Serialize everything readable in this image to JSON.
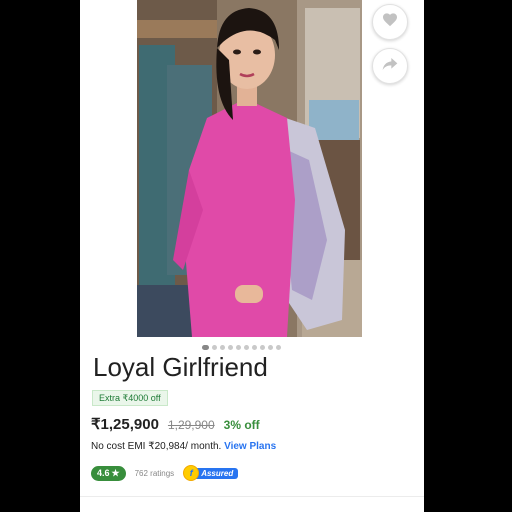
{
  "product": {
    "title": "Loyal Girlfriend",
    "extra_offer": "Extra ₹4000 off",
    "price": "₹1,25,900",
    "mrp": "1,29,900",
    "discount": "3% off",
    "emi_text": "No cost EMI ₹20,984/ month.",
    "emi_link": "View Plans",
    "rating": "4.6",
    "rating_star": "★",
    "ratings_count": "762 ratings",
    "assured_badge": "Assured",
    "assured_mark": "f"
  },
  "gallery": {
    "image": "product-photo",
    "dot_count": 10,
    "active_index": 0
  },
  "actions": {
    "wishlist_icon": "heart-icon",
    "share_icon": "share-icon"
  },
  "colors": {
    "accent": "#2874f0",
    "offer_green": "#388e3c",
    "assured_yellow": "#ffcc00"
  }
}
